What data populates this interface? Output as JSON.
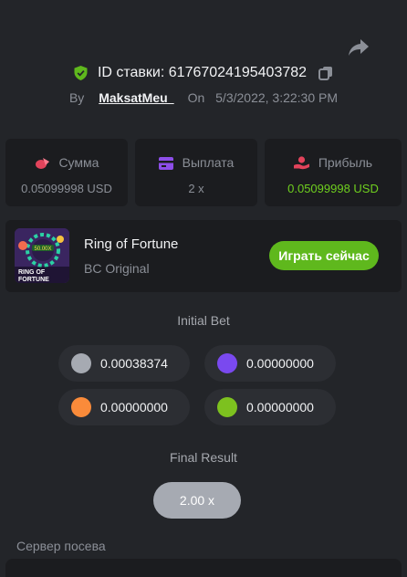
{
  "header": {
    "bet_id_label": "ID ставки:",
    "bet_id": "61767024195403782",
    "by_label": "By",
    "username": "MaksatMeu ",
    "on_label": "On",
    "datetime": "5/3/2022, 3:22:30 PM"
  },
  "stats": [
    {
      "label": "Сумма",
      "value": "0.05099998 USD",
      "icon": "coins-icon",
      "color": "#e2435b"
    },
    {
      "label": "Выплата",
      "value": "2 x",
      "icon": "wallet-card-icon",
      "color": "#8d4ee8"
    },
    {
      "label": "Прибыль",
      "value": "0.05099998 USD",
      "icon": "profit-hand-icon",
      "color": "#e2435b",
      "value_color": "#6fcf1f"
    }
  ],
  "game": {
    "name": "Ring of Fortune",
    "provider": "BC Original",
    "play_label": "Играть сейчас",
    "thumb_text": "RING OF FORTUNE",
    "thumb_badge": "50.00X"
  },
  "initial_bet": {
    "title": "Initial Bet",
    "coins": [
      {
        "amount": "0.00038374",
        "color": "#a6aab2"
      },
      {
        "amount": "0.00000000",
        "color": "#7a49ef"
      },
      {
        "amount": "0.00000000",
        "color": "#fa8b3a"
      },
      {
        "amount": "0.00000000",
        "color": "#7dc11f"
      }
    ]
  },
  "final_result": {
    "title": "Final Result",
    "value": "2.00 x"
  },
  "seed": {
    "label": "Сервер посева"
  },
  "colors": {
    "background": "#232529",
    "card": "#1b1c1f",
    "accent_green": "#5fb81d"
  }
}
